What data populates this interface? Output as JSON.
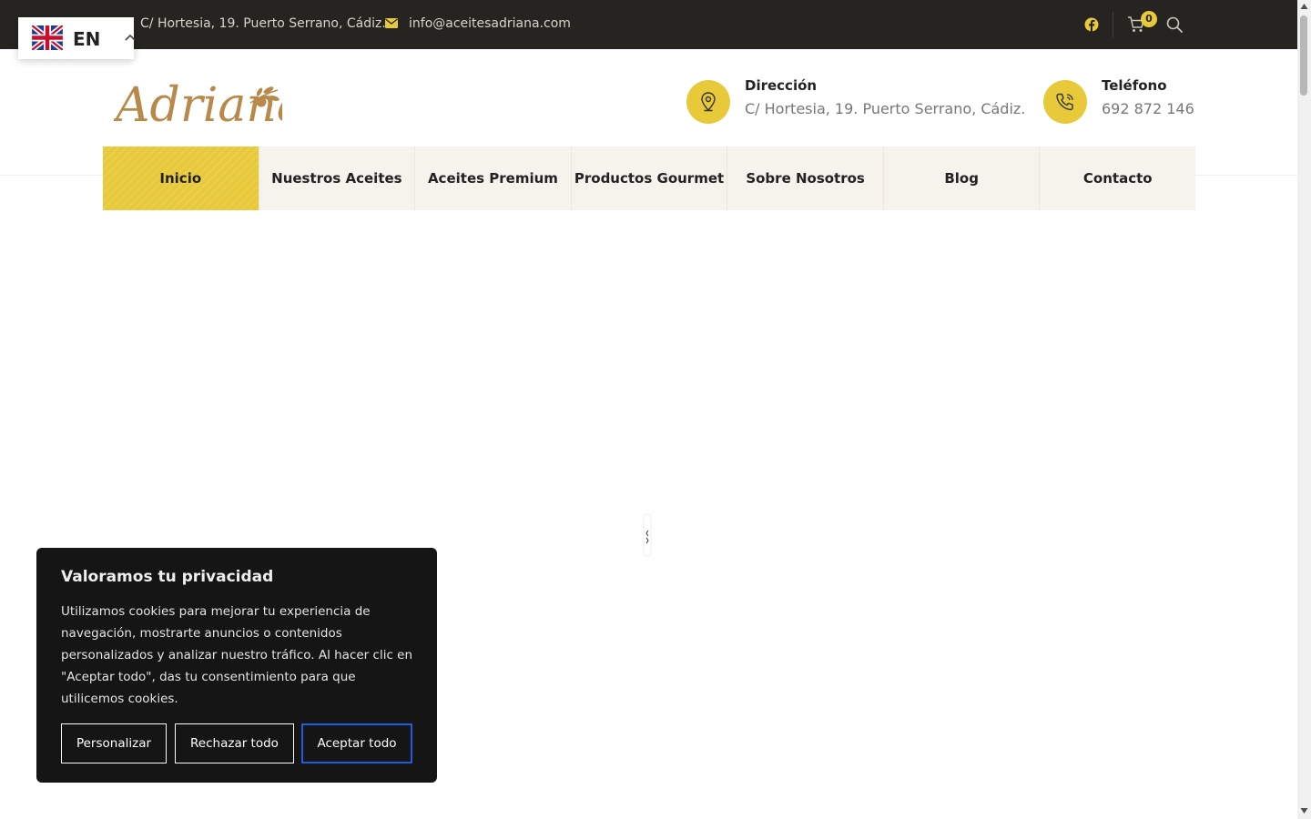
{
  "topbar": {
    "address": "C/ Hortesia, 19. Puerto Serrano, Cádiz.",
    "email": "info@aceitesadriana.com",
    "cart_count": "0",
    "icons": [
      "facebook-icon",
      "cart-icon",
      "search-icon",
      "mail-icon"
    ]
  },
  "language": {
    "code": "EN",
    "flag": "uk-flag-icon"
  },
  "header": {
    "logo_text": "Adriana",
    "address": {
      "title": "Dirección",
      "value": "C/ Hortesia, 19. Puerto Serrano, Cádiz."
    },
    "phone": {
      "title": "Teléfono",
      "value": "692 872 146"
    }
  },
  "nav": {
    "items": [
      {
        "label": "Inicio",
        "active": true
      },
      {
        "label": "Nuestros Aceites",
        "active": false
      },
      {
        "label": "Aceites Premium",
        "active": false
      },
      {
        "label": "Productos Gourmet",
        "active": false
      },
      {
        "label": "Sobre Nosotros",
        "active": false
      },
      {
        "label": "Blog",
        "active": false
      },
      {
        "label": "Contacto",
        "active": false
      }
    ]
  },
  "cookie": {
    "title": "Valoramos tu privacidad",
    "text": "Utilizamos cookies para mejorar tu experiencia de navegación, mostrarte anuncios o contenidos personalizados y analizar nuestro tráfico. Al hacer clic en \"Aceptar todo\", das tu consentimiento para que utilicemos cookies.",
    "customize_label": "Personalizar",
    "reject_label": "Rechazar todo",
    "accept_label": "Aceptar todo"
  },
  "colors": {
    "accent": "#e8c93a",
    "topbar_bg": "#262420",
    "nav_bg": "#f6f3ec",
    "logo": "#b8894a",
    "cookie_bg": "#151515",
    "accept_border": "#1f5de0"
  }
}
